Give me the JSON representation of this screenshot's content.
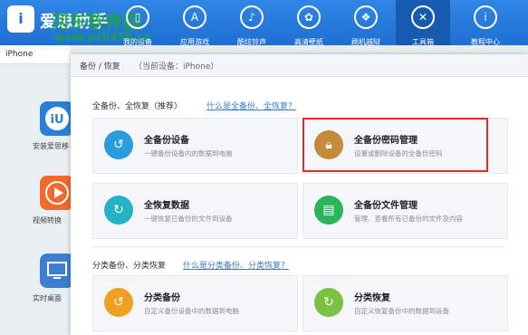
{
  "header": {
    "logo_text": "i",
    "brand": "爱思助手",
    "watermark": "河东软件园",
    "watermark_url": "www.pc0359.cn",
    "nav": [
      {
        "label": "我的设备",
        "icon": "phone-icon"
      },
      {
        "label": "应用游戏",
        "icon": "app-store-icon"
      },
      {
        "label": "酷炫铃声",
        "icon": "bell-icon"
      },
      {
        "label": "高清壁纸",
        "icon": "flower-icon"
      },
      {
        "label": "刷机越狱",
        "icon": "box-icon"
      },
      {
        "label": "工具箱",
        "icon": "tools-icon"
      },
      {
        "label": "教程中心",
        "icon": "info-icon"
      }
    ]
  },
  "sidebar": {
    "device_tab": "iPhone",
    "apps": [
      {
        "label": "安装爱思移",
        "icon": "iu-icon",
        "color": "#2a7fd6"
      },
      {
        "label": "视频转换",
        "icon": "video-icon",
        "color": "#ef6a2c"
      },
      {
        "label": "实时桌面",
        "icon": "monitor-icon",
        "color": "#3c7fd0"
      }
    ]
  },
  "dialog": {
    "title": "备份 / 恢复",
    "subtitle": "（当前设备：iPhone）",
    "section1": {
      "label": "全备份、全恢复（推荐）",
      "help": "什么是全备份、全恢复？"
    },
    "section2": {
      "label": "分类备份、分类恢复",
      "help": "什么是分类备份、分类恢复？"
    },
    "cards": [
      {
        "title": "全备份设备",
        "desc": "一键备份设备内的数据到电脑",
        "color": "#2a9bdc",
        "icon": "backup-icon"
      },
      {
        "title": "全备份密码管理",
        "desc": "设置或删除设备的全备份密码",
        "color": "#c58a3c",
        "icon": "lock-icon"
      },
      {
        "title": "全恢复数据",
        "desc": "一键恢复已备份的文件到设备",
        "color": "#24b3c4",
        "icon": "restore-icon"
      },
      {
        "title": "全备份文件管理",
        "desc": "管理、查看所有已备份的文件及内容",
        "color": "#2db35a",
        "icon": "folder-icon"
      },
      {
        "title": "分类备份",
        "desc": "自定义备份设备中的数据到电脑",
        "color": "#f0a020",
        "icon": "category-backup-icon"
      },
      {
        "title": "分类恢复",
        "desc": "自定义恢复备份中的数据到设备",
        "color": "#7cc142",
        "icon": "category-restore-icon"
      }
    ]
  }
}
